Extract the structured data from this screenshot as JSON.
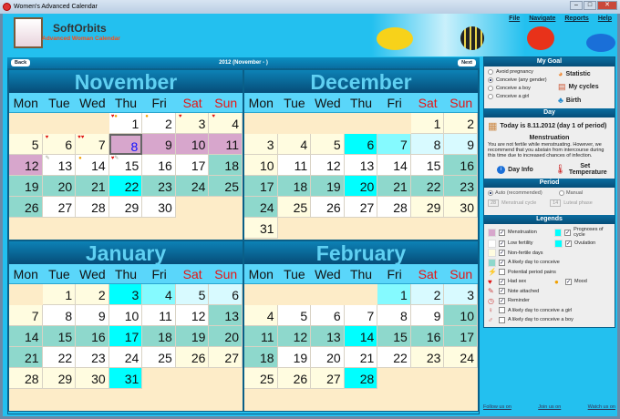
{
  "window": {
    "title": "Women's Advanced Calendar",
    "min": "–",
    "max": "□",
    "close": "✕"
  },
  "header": {
    "brand": "SoftOrbits",
    "subtitle": "Advanced Woman Calendar",
    "menu": [
      "File",
      "Navigate",
      "Reports",
      "Help"
    ]
  },
  "nav": {
    "back": "Back",
    "next": "Next",
    "title": "2012 (November - )"
  },
  "dows": [
    "Mon",
    "Tue",
    "Wed",
    "Thu",
    "Fri",
    "Sat",
    "Sun"
  ],
  "months": [
    {
      "name": "November",
      "offset": 3,
      "days": [
        "w",
        "w",
        "n",
        "n",
        "n",
        "n",
        "n",
        "m",
        "m",
        "m",
        "m",
        "m",
        "w",
        "w",
        "w",
        "w",
        "w",
        "l",
        "l",
        "l",
        "l",
        "o",
        "l",
        "l",
        "l",
        "l",
        "w",
        "w",
        "w",
        "w"
      ],
      "today": 8,
      "icons": {
        "1": "♥●",
        "2": "●",
        "3": "♥",
        "4": "♥",
        "6": "♥",
        "7": "♥♥",
        "13": "✎",
        "14": "●",
        "15": "♥✎"
      }
    },
    {
      "name": "December",
      "offset": 5,
      "days": [
        "n",
        "n",
        "n",
        "n",
        "n",
        "o",
        "p",
        "q",
        "q",
        "n",
        "w",
        "w",
        "w",
        "w",
        "w",
        "l",
        "l",
        "l",
        "l",
        "o",
        "l",
        "l",
        "l",
        "l",
        "n",
        "w",
        "w",
        "w",
        "n",
        "n",
        "n"
      ]
    },
    {
      "name": "January",
      "offset": 1,
      "days": [
        "n",
        "n",
        "o",
        "p",
        "q",
        "q",
        "n",
        "w",
        "w",
        "w",
        "w",
        "w",
        "l",
        "l",
        "l",
        "l",
        "o",
        "l",
        "l",
        "l",
        "l",
        "w",
        "w",
        "w",
        "w",
        "n",
        "n",
        "n",
        "n",
        "n",
        "o"
      ]
    },
    {
      "name": "February",
      "offset": 4,
      "days": [
        "p",
        "q",
        "q",
        "n",
        "w",
        "w",
        "w",
        "w",
        "w",
        "l",
        "l",
        "l",
        "l",
        "o",
        "l",
        "l",
        "l",
        "l",
        "w",
        "w",
        "w",
        "w",
        "n",
        "n",
        "n",
        "n",
        "n",
        "o"
      ]
    }
  ],
  "goal": {
    "title": "My Goal",
    "options": [
      "Avoid pregnancy",
      "Conceive (any gender)",
      "Conceive a boy",
      "Conceive a girl"
    ],
    "selected": 1,
    "buttons": [
      "Statistic",
      "My cycles",
      "Birth"
    ]
  },
  "day": {
    "title": "Day",
    "today": "Today is 8.11.2012 (day 1 of period)",
    "heading": "Menstruation",
    "text": "You are not fertile while menstruating. However, we recommend that you abstain from intercourse during this time due to increased chances of infection.",
    "info": "Day Info",
    "temp": "Set Temperature"
  },
  "period": {
    "title": "Period",
    "auto": "Auto (recommended)",
    "manual": "Manual",
    "cycle": "28",
    "cycle_label": "Menstrual cycle",
    "luteal": "14",
    "luteal_label": "Luteal phase"
  },
  "legends": {
    "title": "Legends",
    "items": [
      {
        "label": "Menstruation",
        "checked": true,
        "color": "#d7a6cc"
      },
      {
        "label": "Prognoses of cycle",
        "checked": true,
        "color": "#00ffff"
      },
      {
        "label": "Low fertility",
        "checked": true,
        "color": "#ffffff"
      },
      {
        "label": "Ovulation",
        "checked": true,
        "color": "#00ffff"
      },
      {
        "label": "Non-fertile days",
        "checked": true,
        "color": "#fffce0"
      },
      {
        "label": "A likely day to conceive",
        "checked": true,
        "color": "#8ed8cc"
      },
      {
        "label": "Potential period pains",
        "checked": false,
        "icon": "⚡"
      },
      {
        "label": "Had sex",
        "checked": true,
        "icon": "♥"
      },
      {
        "label": "Mood",
        "checked": true,
        "icon": "●"
      },
      {
        "label": "Note attached",
        "checked": true,
        "icon": "✎"
      },
      {
        "label": "Reminder",
        "checked": true,
        "icon": "◷"
      },
      {
        "label": "A likely day to conceive a girl",
        "checked": false,
        "icon": "♀"
      },
      {
        "label": "A likely day to conceive a boy",
        "checked": false,
        "icon": "♂"
      }
    ]
  },
  "footer": [
    "Follow us on",
    "Join us on",
    "Watch us on"
  ]
}
